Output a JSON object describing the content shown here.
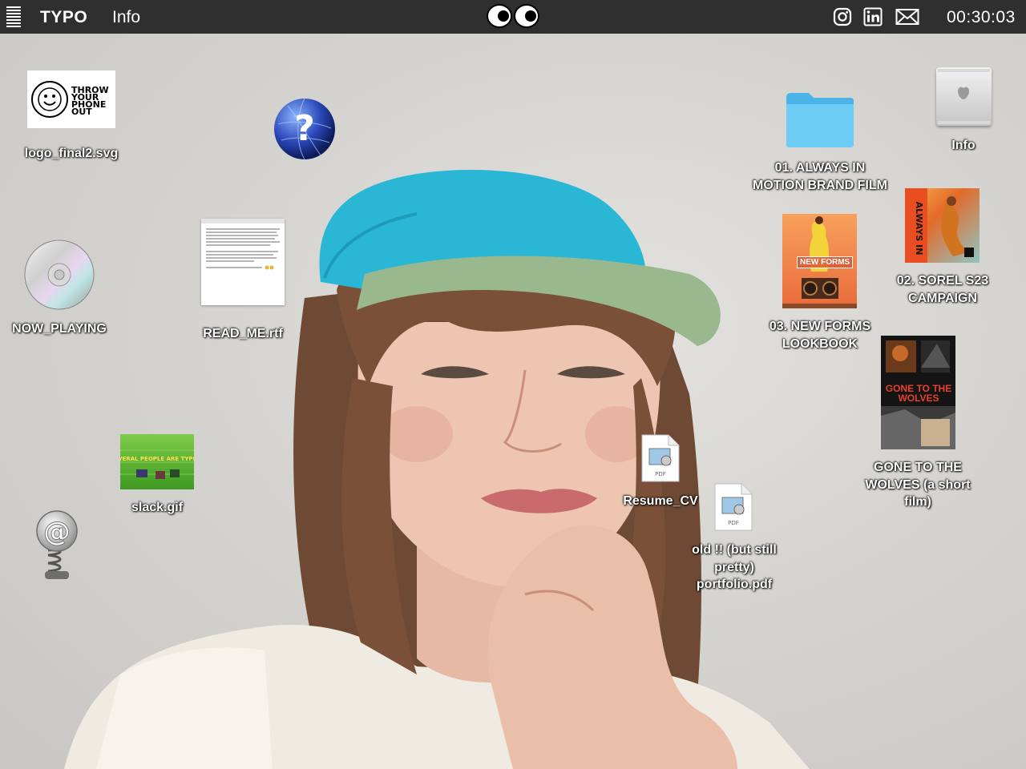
{
  "menubar": {
    "brand": "TYPO",
    "info": "Info",
    "clock": "00:30:03",
    "icons": [
      "menu-icon",
      "eyes-icon",
      "instagram-icon",
      "linkedin-icon",
      "mail-icon"
    ]
  },
  "logo": {
    "label": "logo_final2.svg",
    "art_text": [
      "THROW",
      "YOUR",
      "PHONE",
      "OUT"
    ]
  },
  "help_globe": {
    "icon": "question-globe-icon"
  },
  "now_playing": {
    "label": "NOW_PLAYING",
    "icon": "cd-icon"
  },
  "read_me": {
    "label": "READ_ME.rtf"
  },
  "slack": {
    "label": "slack.gif",
    "art_text": "SEVERAL PEOPLE ARE TYPING"
  },
  "mail_spring": {
    "icon": "at-sign-spring-icon"
  },
  "resume": {
    "label": "Resume_CV",
    "doc_tag": "PDF"
  },
  "old_portfolio": {
    "label": "old !! (but still pretty) portfolio.pdf",
    "lines": [
      "old !! (but still",
      "pretty)",
      "portfolio.pdf"
    ],
    "doc_tag": "PDF"
  },
  "always_in_motion": {
    "lines": [
      "01. ALWAYS IN",
      "MOTION BRAND FILM"
    ]
  },
  "mac_info": {
    "label": "Info"
  },
  "sorel": {
    "lines": [
      "02. SOREL S23",
      "CAMPAIGN"
    ],
    "poster_text": "ALWAYS IN"
  },
  "new_forms": {
    "lines": [
      "03. NEW FORMS",
      "LOOKBOOK"
    ],
    "poster_text": "NEW FORMS"
  },
  "wolves": {
    "lines": [
      "GONE TO THE",
      "WOLVES (a short",
      "film)"
    ],
    "poster_text": "GONE TO THE WOLVES"
  },
  "colors": {
    "menubar": "#2f2f2f",
    "folder": "#5ec3f0",
    "cap": "#2ab7d6",
    "brim": "#9ab88e",
    "lips": "#c96a6c"
  }
}
